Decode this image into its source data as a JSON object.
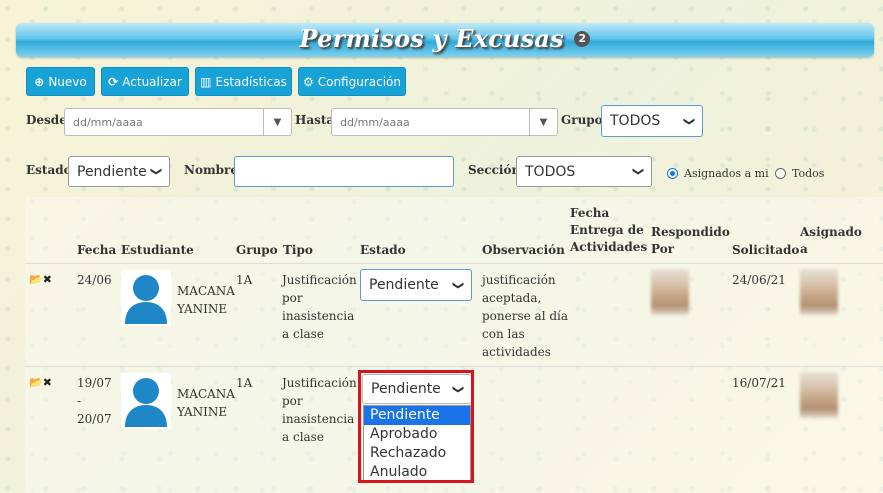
{
  "header": {
    "title": "Permisos y Excusas",
    "badge": "2"
  },
  "toolbar": {
    "nuevo": "Nuevo",
    "actualizar": "Actualizar",
    "estadisticas": "Estadísticas",
    "configuracion": "Configuración"
  },
  "filters": {
    "desde_label": "Desde",
    "desde_placeholder": "dd/mm/aaaa",
    "hasta_label": "Hasta",
    "hasta_placeholder": "dd/mm/aaaa",
    "grupo_label": "Grupo",
    "grupo_value": "TODOS",
    "estado_label": "Estado",
    "estado_value": "Pendiente",
    "nombre_label": "Nombre",
    "nombre_value": "",
    "seccion_label": "Sección",
    "seccion_value": "TODOS",
    "radio_asignados": "Asignados a mi",
    "radio_todos": "Todos"
  },
  "table": {
    "headers": {
      "fecha": "Fecha",
      "estudiante": "Estudiante",
      "grupo": "Grupo",
      "tipo": "Tipo",
      "estado": "Estado",
      "observacion": "Observación",
      "entrega_l1": "Fecha",
      "entrega_l2": "Entrega de",
      "entrega_l3": "Actividades",
      "respondido_l1": "Respondido",
      "respondido_l2": "Por",
      "solicitado": "Solicitado",
      "asignado_l1": "Asignado",
      "asignado_l2": "a"
    },
    "rows": [
      {
        "fecha_l1": "24/06",
        "nombre_l1": "MACANA",
        "nombre_l2": "YANINE",
        "grupo": "1A",
        "tipo_l1": "Justificación",
        "tipo_l2": "por",
        "tipo_l3": "inasistencia",
        "tipo_l4": "a clase",
        "estado": "Pendiente",
        "obs_l1": "justificación",
        "obs_l2": "aceptada,",
        "obs_l3": "ponerse al día",
        "obs_l4": "con las",
        "obs_l5": "actividades",
        "solicitado": "24/06/21"
      },
      {
        "fecha_l1": "19/07",
        "fecha_l2": "-",
        "fecha_l3": "20/07",
        "nombre_l1": "MACANA",
        "nombre_l2": "YANINE",
        "grupo": "1A",
        "tipo_l1": "Justificación",
        "tipo_l2": "por",
        "tipo_l3": "inasistencia",
        "tipo_l4": "a clase",
        "estado": "Pendiente",
        "solicitado": "16/07/21"
      }
    ]
  },
  "estado_dropdown": {
    "options": [
      "Pendiente",
      "Aprobado",
      "Rechazado",
      "Anulado"
    ],
    "highlight_color": "#d9141c"
  }
}
